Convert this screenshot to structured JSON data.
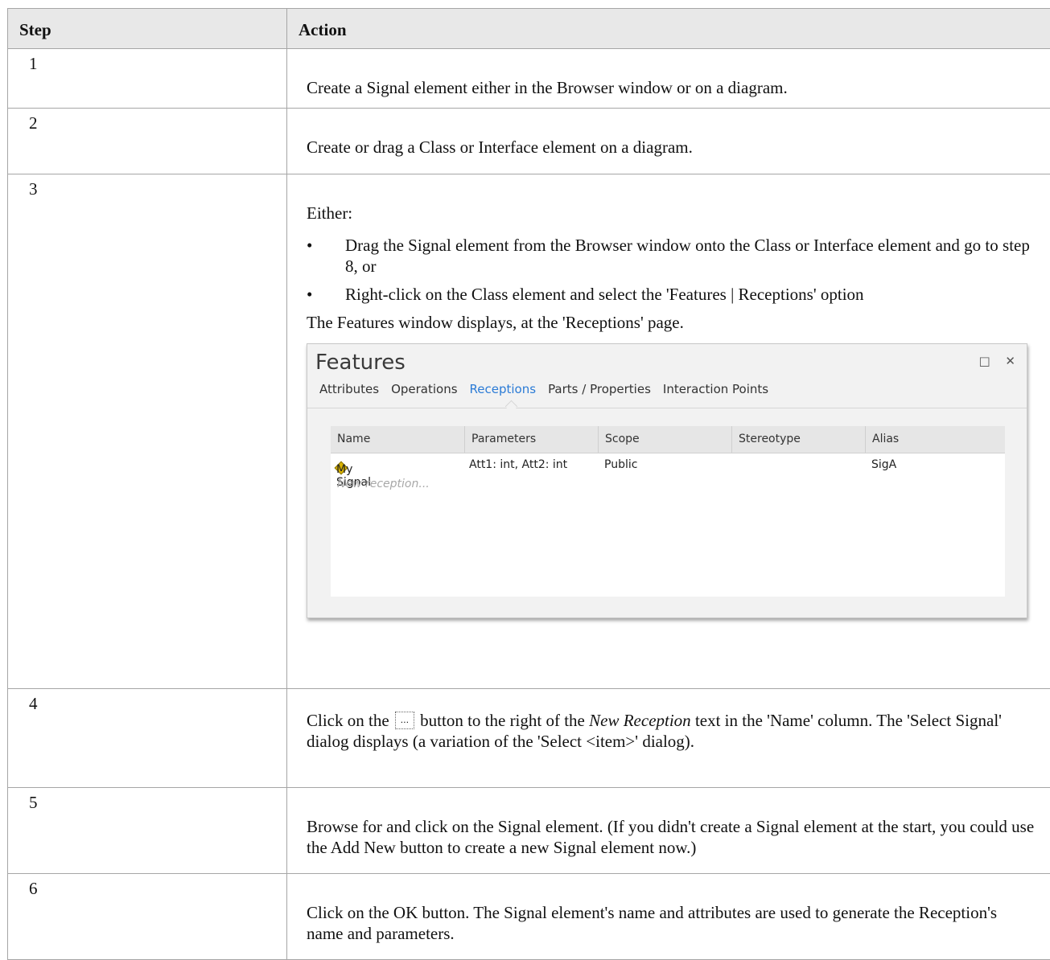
{
  "header": {
    "step": "Step",
    "action": "Action"
  },
  "rows": [
    {
      "step": "1",
      "text": "Create a Signal element either in the Browser window or on a diagram."
    },
    {
      "step": "2",
      "text": "Create or drag a Class or Interface element on a diagram."
    },
    {
      "step": "3",
      "intro": "Either:",
      "bullets": [
        "Drag the Signal element from the Browser window onto the Class or Interface element and go to step 8, or",
        "Right-click on the Class element and select the 'Features | Receptions' option"
      ],
      "after": "The Features window displays, at the 'Receptions' page."
    },
    {
      "step": "4",
      "pre": "Click on the",
      "button_label": "...",
      "mid": "button to the right of the",
      "italic": "New Reception",
      "post": "text in the 'Name' column. The 'Select Signal' dialog displays (a variation of the 'Select <item>' dialog)."
    },
    {
      "step": "5",
      "text": "Browse for and click on the Signal element. (If you didn't create a Signal element at the start, you could use the Add New button to create a new Signal element now.)"
    },
    {
      "step": "6",
      "text": "Click on the OK button. The Signal element's name and attributes are used to generate the Reception's name and parameters."
    }
  ],
  "bullet_symbol": "•",
  "features": {
    "title": "Features",
    "maximize_icon": "□",
    "close_icon": "✕",
    "tabs": [
      "Attributes",
      "Operations",
      "Receptions",
      "Parts / Properties",
      "Interaction Points"
    ],
    "active_tab": "Receptions",
    "columns": [
      "Name",
      "Parameters",
      "Scope",
      "Stereotype",
      "Alias"
    ],
    "row": {
      "name": "My Signal",
      "parameters": "Att1: int, Att2: int",
      "scope": "Public",
      "stereotype": "",
      "alias": "SigA"
    },
    "new_row_placeholder": "New reception...",
    "accent_color": "#2b7bd6"
  }
}
